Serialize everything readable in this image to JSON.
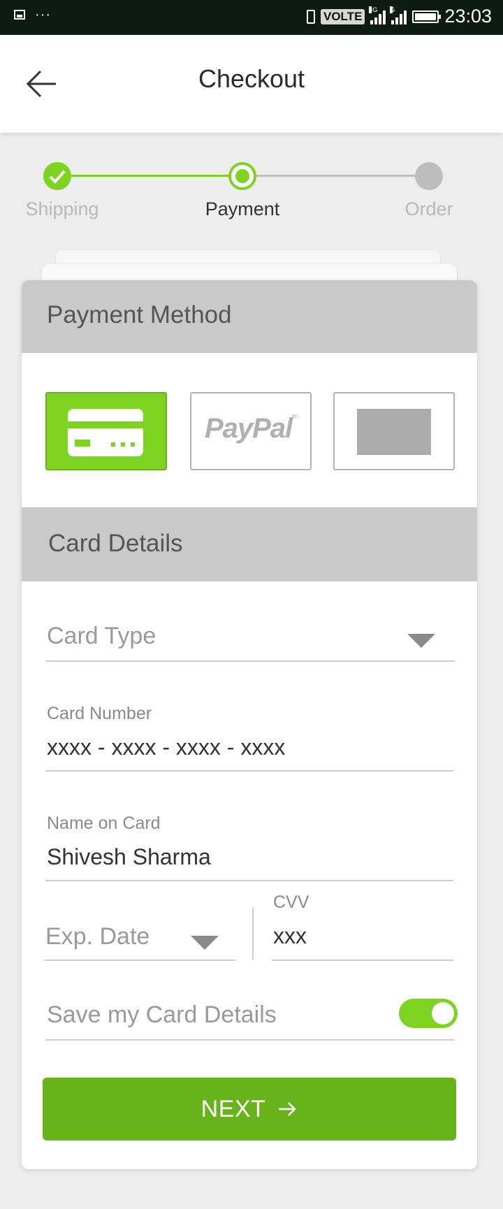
{
  "status_bar": {
    "network_label": "VOLTE",
    "sim1_tag": "4G",
    "sim2_tag": "G",
    "time": "23:03",
    "icons": [
      "gallery-icon",
      "more-icon",
      "vibrate-icon",
      "signal-icon",
      "battery-icon"
    ]
  },
  "header": {
    "title": "Checkout",
    "back_icon": "arrow-left-icon"
  },
  "stepper": {
    "steps": [
      {
        "label": "Shipping",
        "state": "done"
      },
      {
        "label": "Payment",
        "state": "active"
      },
      {
        "label": "Order",
        "state": "pending"
      }
    ]
  },
  "payment_method": {
    "heading": "Payment Method",
    "options": [
      {
        "name": "credit-card",
        "selected": true
      },
      {
        "name": "paypal",
        "label": "PayPal",
        "mark": "tm",
        "selected": false
      },
      {
        "name": "other-card",
        "selected": false
      }
    ]
  },
  "card_details": {
    "heading": "Card Details",
    "card_type": {
      "placeholder": "Card Type"
    },
    "card_number": {
      "label": "Card Number",
      "value": "xxxx - xxxx - xxxx - xxxx"
    },
    "name_on_card": {
      "label": "Name on Card",
      "value": "Shivesh Sharma"
    },
    "exp_date": {
      "placeholder": "Exp. Date"
    },
    "cvv": {
      "label": "CVV",
      "value": "xxx"
    },
    "save_card": {
      "label": "Save my Card Details",
      "enabled": true
    }
  },
  "next_button": {
    "label": "NEXT",
    "icon": "arrow-right-icon"
  },
  "colors": {
    "accent": "#7ed321",
    "button": "#67b31a",
    "section_header": "#c9c9c9",
    "pending_step": "#bdbdbd"
  }
}
